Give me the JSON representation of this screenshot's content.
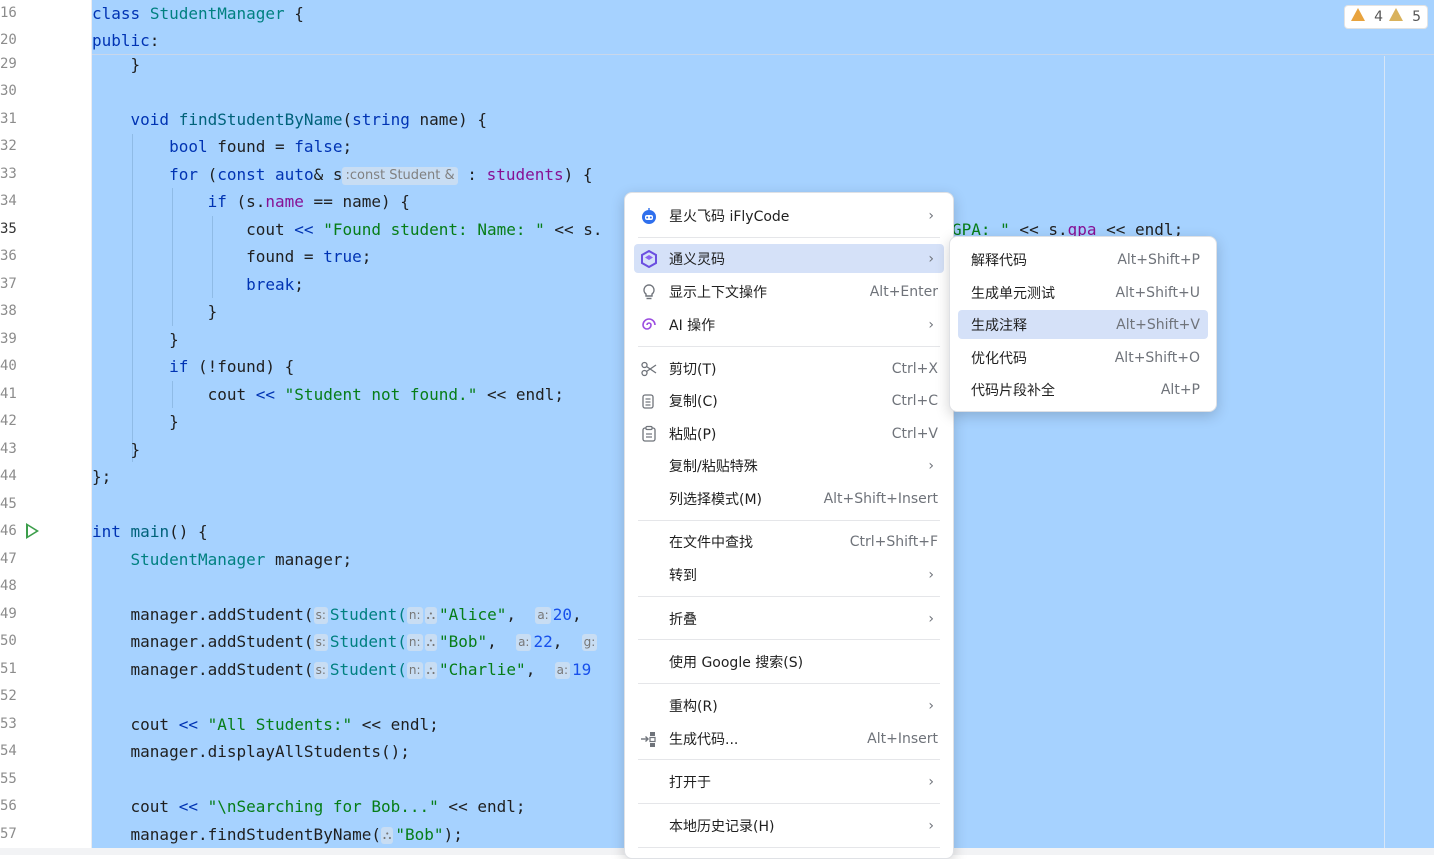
{
  "gutter": {
    "line_numbers": [
      "16",
      "20",
      "29",
      "30",
      "31",
      "32",
      "33",
      "34",
      "35",
      "36",
      "37",
      "38",
      "39",
      "40",
      "41",
      "42",
      "43",
      "44",
      "45",
      "46",
      "47",
      "48",
      "49",
      "50",
      "51",
      "52",
      "53",
      "54",
      "55",
      "56",
      "57"
    ]
  },
  "editor": {
    "warnings": {
      "count_a": "4",
      "count_b": "5"
    },
    "lines": {
      "l16": {
        "kw": "class",
        "cls": "StudentManager",
        "rest": " {"
      },
      "l20": {
        "kw": "public",
        "rest": ":"
      },
      "l29": {
        "rest": "    }"
      },
      "l31": {
        "indent": "    ",
        "kw": "void",
        "fn": "findStudentByName",
        "p1": "(",
        "t": "string",
        "p2": " name) {"
      },
      "l32": {
        "indent": "        ",
        "kw": "bool",
        "mid": " found = ",
        "val": "false",
        "end": ";"
      },
      "l33": {
        "indent": "        ",
        "kw": "for",
        "a": " (",
        "kw2": "const",
        "b": " ",
        "kw3": "auto",
        "c": "& s",
        "hint": ":const Student &",
        "d": " : ",
        "fld": "students",
        "e": ") {"
      },
      "l34": {
        "indent": "            ",
        "kw": "if",
        "a": " (s.",
        "fld": "name",
        "b": " == name) {"
      },
      "l35": {
        "indent": "                ",
        "a": "cout ",
        "op": "<<",
        "str": " \"Found student: Name: \"",
        "b": " << s.",
        "tail_str": "GPA: \"",
        "tail": " << s.",
        "tail_fld": "gpa",
        "tail_end": " << endl;"
      },
      "l36": {
        "indent": "                ",
        "a": "found = ",
        "kw": "true",
        "end": ";"
      },
      "l37": {
        "indent": "                ",
        "kw": "break",
        "end": ";"
      },
      "l38": {
        "rest": "            }"
      },
      "l39": {
        "rest": "        }"
      },
      "l40": {
        "indent": "        ",
        "kw": "if",
        "a": " (!found) {"
      },
      "l41": {
        "indent": "            ",
        "a": "cout ",
        "op": "<<",
        "str": " \"Student not found.\"",
        "b": " << endl;"
      },
      "l42": {
        "rest": "        }"
      },
      "l43": {
        "rest": "    }"
      },
      "l44": {
        "rest": "};"
      },
      "l46": {
        "kw": "int",
        "fn": "main",
        "rest": "() {"
      },
      "l47": {
        "indent": "    ",
        "cls": "StudentManager",
        "rest": " manager;"
      },
      "l49": {
        "indent": "    ",
        "a": "manager.addStudent(",
        "h1": "s:",
        "cls": "Student(",
        "h2": "n:",
        "h3": "⛬",
        "str": "\"Alice\"",
        "b": ",  ",
        "h4": "a:",
        "num": "20",
        "c": ","
      },
      "l50": {
        "indent": "    ",
        "a": "manager.addStudent(",
        "h1": "s:",
        "cls": "Student(",
        "h2": "n:",
        "h3": "⛬",
        "str": "\"Bob\"",
        "b": ",  ",
        "h4": "a:",
        "num": "22",
        "c": ",  ",
        "h5": "g:"
      },
      "l51": {
        "indent": "    ",
        "a": "manager.addStudent(",
        "h1": "s:",
        "cls": "Student(",
        "h2": "n:",
        "h3": "⛬",
        "str": "\"Charlie\"",
        "b": ",  ",
        "h4": "a:",
        "num": "19"
      },
      "l53": {
        "indent": "    ",
        "a": "cout ",
        "op": "<<",
        "str": " \"All Students:\"",
        "b": " << endl;"
      },
      "l54": {
        "rest": "    manager.displayAllStudents();"
      },
      "l56": {
        "indent": "    ",
        "a": "cout ",
        "op": "<<",
        "str": " \"\\nSearching for Bob...\"",
        "b": " << endl;"
      },
      "l57": {
        "indent": "    ",
        "a": "manager.findStudentByName(",
        "h3": "⛬",
        "str": "\"Bob\"",
        "b": ");"
      }
    }
  },
  "context_menu": {
    "items": [
      {
        "label": "星火飞码 iFlyCode",
        "shortcut": "",
        "submenu": true,
        "icon": "iflycode-icon"
      },
      {
        "label": "通义灵码",
        "shortcut": "",
        "submenu": true,
        "icon": "tongyi-icon",
        "selected": true
      },
      {
        "label": "显示上下文操作",
        "shortcut": "Alt+Enter",
        "icon": "bulb-icon"
      },
      {
        "label": "AI 操作",
        "shortcut": "",
        "submenu": true,
        "icon": "ai-spiral-icon"
      },
      {
        "label": "剪切(T)",
        "shortcut": "Ctrl+X",
        "icon": "scissors-icon"
      },
      {
        "label": "复制(C)",
        "shortcut": "Ctrl+C",
        "icon": "copy-icon"
      },
      {
        "label": "粘贴(P)",
        "shortcut": "Ctrl+V",
        "icon": "paste-icon"
      },
      {
        "label": "复制/粘贴特殊",
        "shortcut": "",
        "submenu": true
      },
      {
        "label": "列选择模式(M)",
        "shortcut": "Alt+Shift+Insert"
      },
      {
        "label": "在文件中查找",
        "shortcut": "Ctrl+Shift+F"
      },
      {
        "label": "转到",
        "shortcut": "",
        "submenu": true
      },
      {
        "label": "折叠",
        "shortcut": "",
        "submenu": true
      },
      {
        "label": "使用 Google 搜索(S)",
        "shortcut": ""
      },
      {
        "label": "重构(R)",
        "shortcut": "",
        "submenu": true
      },
      {
        "label": "生成代码...",
        "shortcut": "Alt+Insert",
        "icon": "generate-icon"
      },
      {
        "label": "打开于",
        "shortcut": "",
        "submenu": true
      },
      {
        "label": "本地历史记录(H)",
        "shortcut": "",
        "submenu": true
      }
    ]
  },
  "submenu": {
    "items": [
      {
        "label": "解释代码",
        "shortcut": "Alt+Shift+P"
      },
      {
        "label": "生成单元测试",
        "shortcut": "Alt+Shift+U"
      },
      {
        "label": "生成注释",
        "shortcut": "Alt+Shift+V",
        "selected": true
      },
      {
        "label": "优化代码",
        "shortcut": "Alt+Shift+O"
      },
      {
        "label": "代码片段补全",
        "shortcut": "Alt+P"
      }
    ]
  },
  "colors": {
    "selection": "#a6d2ff",
    "menu_highlight": "#d5e1f8",
    "keyword": "#0033b3",
    "string": "#067d17"
  }
}
